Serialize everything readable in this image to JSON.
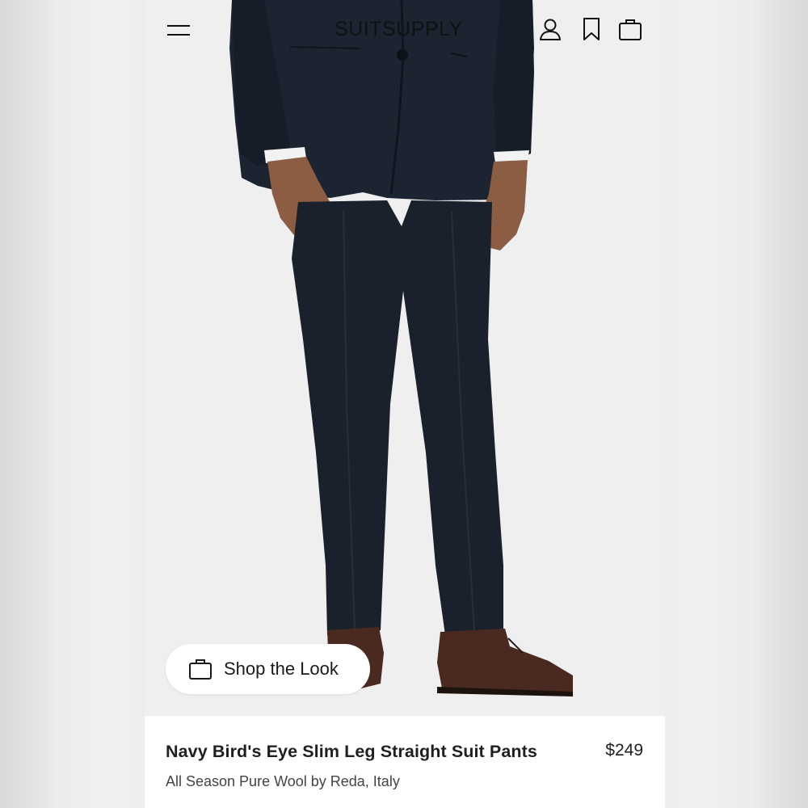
{
  "header": {
    "brand": "SUITSUPPLY",
    "menu_icon": "hamburger-menu-icon",
    "account_icon": "user-icon",
    "wishlist_icon": "bookmark-icon",
    "bag_icon": "shopping-bag-icon"
  },
  "hero": {
    "image_alt": "Model wearing navy suit pants with brown oxford shoes",
    "shop_the_look_label": "Shop the Look",
    "shop_the_look_icon": "shopping-bag-icon"
  },
  "product": {
    "title": "Navy Bird's Eye Slim Leg Straight Suit Pants",
    "price": "$249",
    "subtitle": "All Season Pure Wool by Reda, Italy"
  },
  "colors": {
    "page_bg": "#ffffff",
    "hero_bg": "#efefef",
    "suit_navy": "#1b2230",
    "shoe_brown": "#4a2a20"
  }
}
